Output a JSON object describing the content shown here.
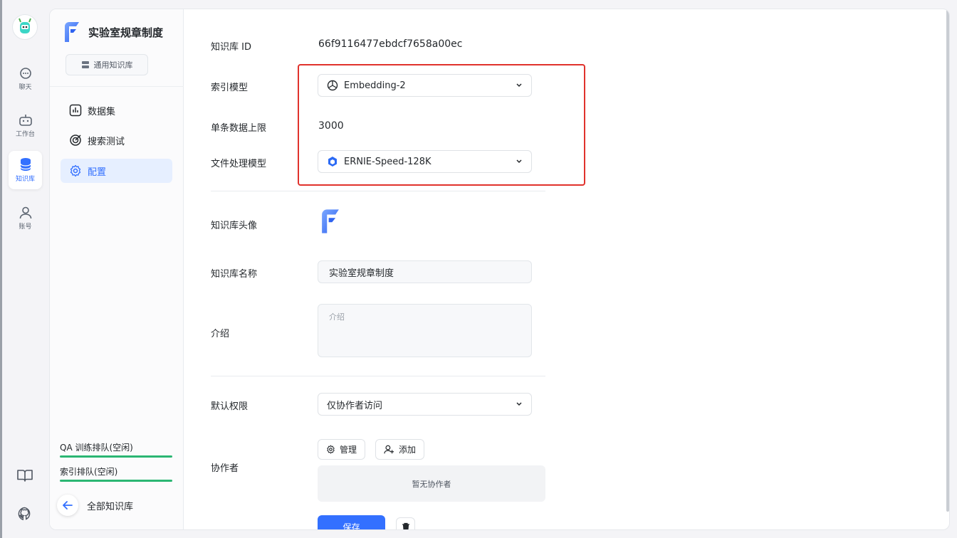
{
  "rail": {
    "items": [
      {
        "label": "聊天",
        "icon": "chat-icon"
      },
      {
        "label": "工作台",
        "icon": "robot-icon"
      },
      {
        "label": "知识库",
        "icon": "database-icon"
      },
      {
        "label": "账号",
        "icon": "user-icon"
      }
    ],
    "bottom_icons": [
      "book-icon",
      "github-icon"
    ]
  },
  "sidebar": {
    "kb_title": "实验室规章制度",
    "kb_type": "通用知识库",
    "menu": [
      {
        "label": "数据集",
        "icon": "chart-icon"
      },
      {
        "label": "搜索测试",
        "icon": "target-icon"
      },
      {
        "label": "配置",
        "icon": "gear-icon",
        "active": true
      }
    ],
    "queues": [
      {
        "label": "QA 训练排队(空闲)"
      },
      {
        "label": "索引排队(空闲)"
      }
    ],
    "back_label": "全部知识库"
  },
  "form": {
    "id_label": "知识库 ID",
    "id_value": "66f9116477ebdcf7658a00ec",
    "index_model_label": "索引模型",
    "index_model_value": "Embedding-2",
    "max_data_label": "单条数据上限",
    "max_data_value": "3000",
    "file_model_label": "文件处理模型",
    "file_model_value": "ERNIE-Speed-128K",
    "avatar_label": "知识库头像",
    "name_label": "知识库名称",
    "name_value": "实验室规章制度",
    "intro_label": "介绍",
    "intro_placeholder": "介绍",
    "permission_label": "默认权限",
    "permission_value": "仅协作者访问",
    "collaborators_label": "协作者",
    "manage_label": "管理",
    "add_label": "添加",
    "no_collaborators": "暂无协作者",
    "save_label": "保存"
  },
  "colors": {
    "accent": "#3370ff",
    "highlight_box": "#e0322c",
    "queue_bar": "#2bb673"
  }
}
